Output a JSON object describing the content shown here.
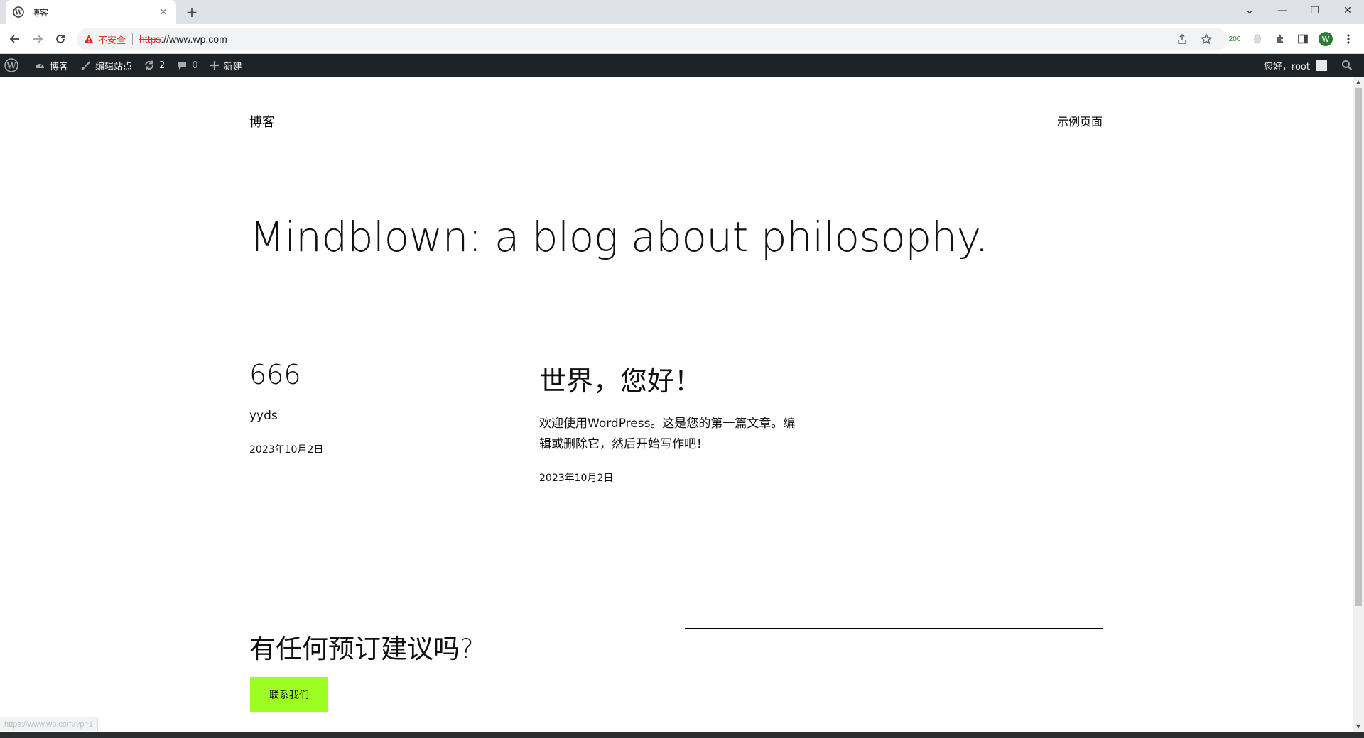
{
  "browser": {
    "tab_title": "博客",
    "tab_close": "×",
    "new_tab": "+",
    "window_controls": {
      "tablist": "⌄",
      "minimize": "—",
      "restore": "❐",
      "close": "✕"
    },
    "address": {
      "security_label": "不安全",
      "scheme": "https",
      "rest": "://www.wp.com"
    },
    "extension_badge": "200",
    "avatar_letter": "W"
  },
  "adminbar": {
    "site_name": "博客",
    "customize": "编辑站点",
    "updates_count": "2",
    "comments_count": "0",
    "new_label": "新建",
    "greeting": "您好，root"
  },
  "site": {
    "title": "博客",
    "nav_page": "示例页面",
    "tagline": "Mindblown: a blog about philosophy."
  },
  "posts": [
    {
      "title": "666",
      "excerpt_lines": [
        "yyds"
      ],
      "date": "2023年10月2日"
    },
    {
      "title": "世界，您好！",
      "excerpt_lines": [
        "欢迎使用WordPress。这是您的第一篇文章。编",
        "辑或删除它，然后开始写作吧！"
      ],
      "date": "2023年10月2日"
    }
  ],
  "cta": {
    "title": "有任何预订建议吗?",
    "button": "联系我们",
    "button_color": "#9dff20"
  },
  "status_url": "https://www.wp.com/?p=1"
}
